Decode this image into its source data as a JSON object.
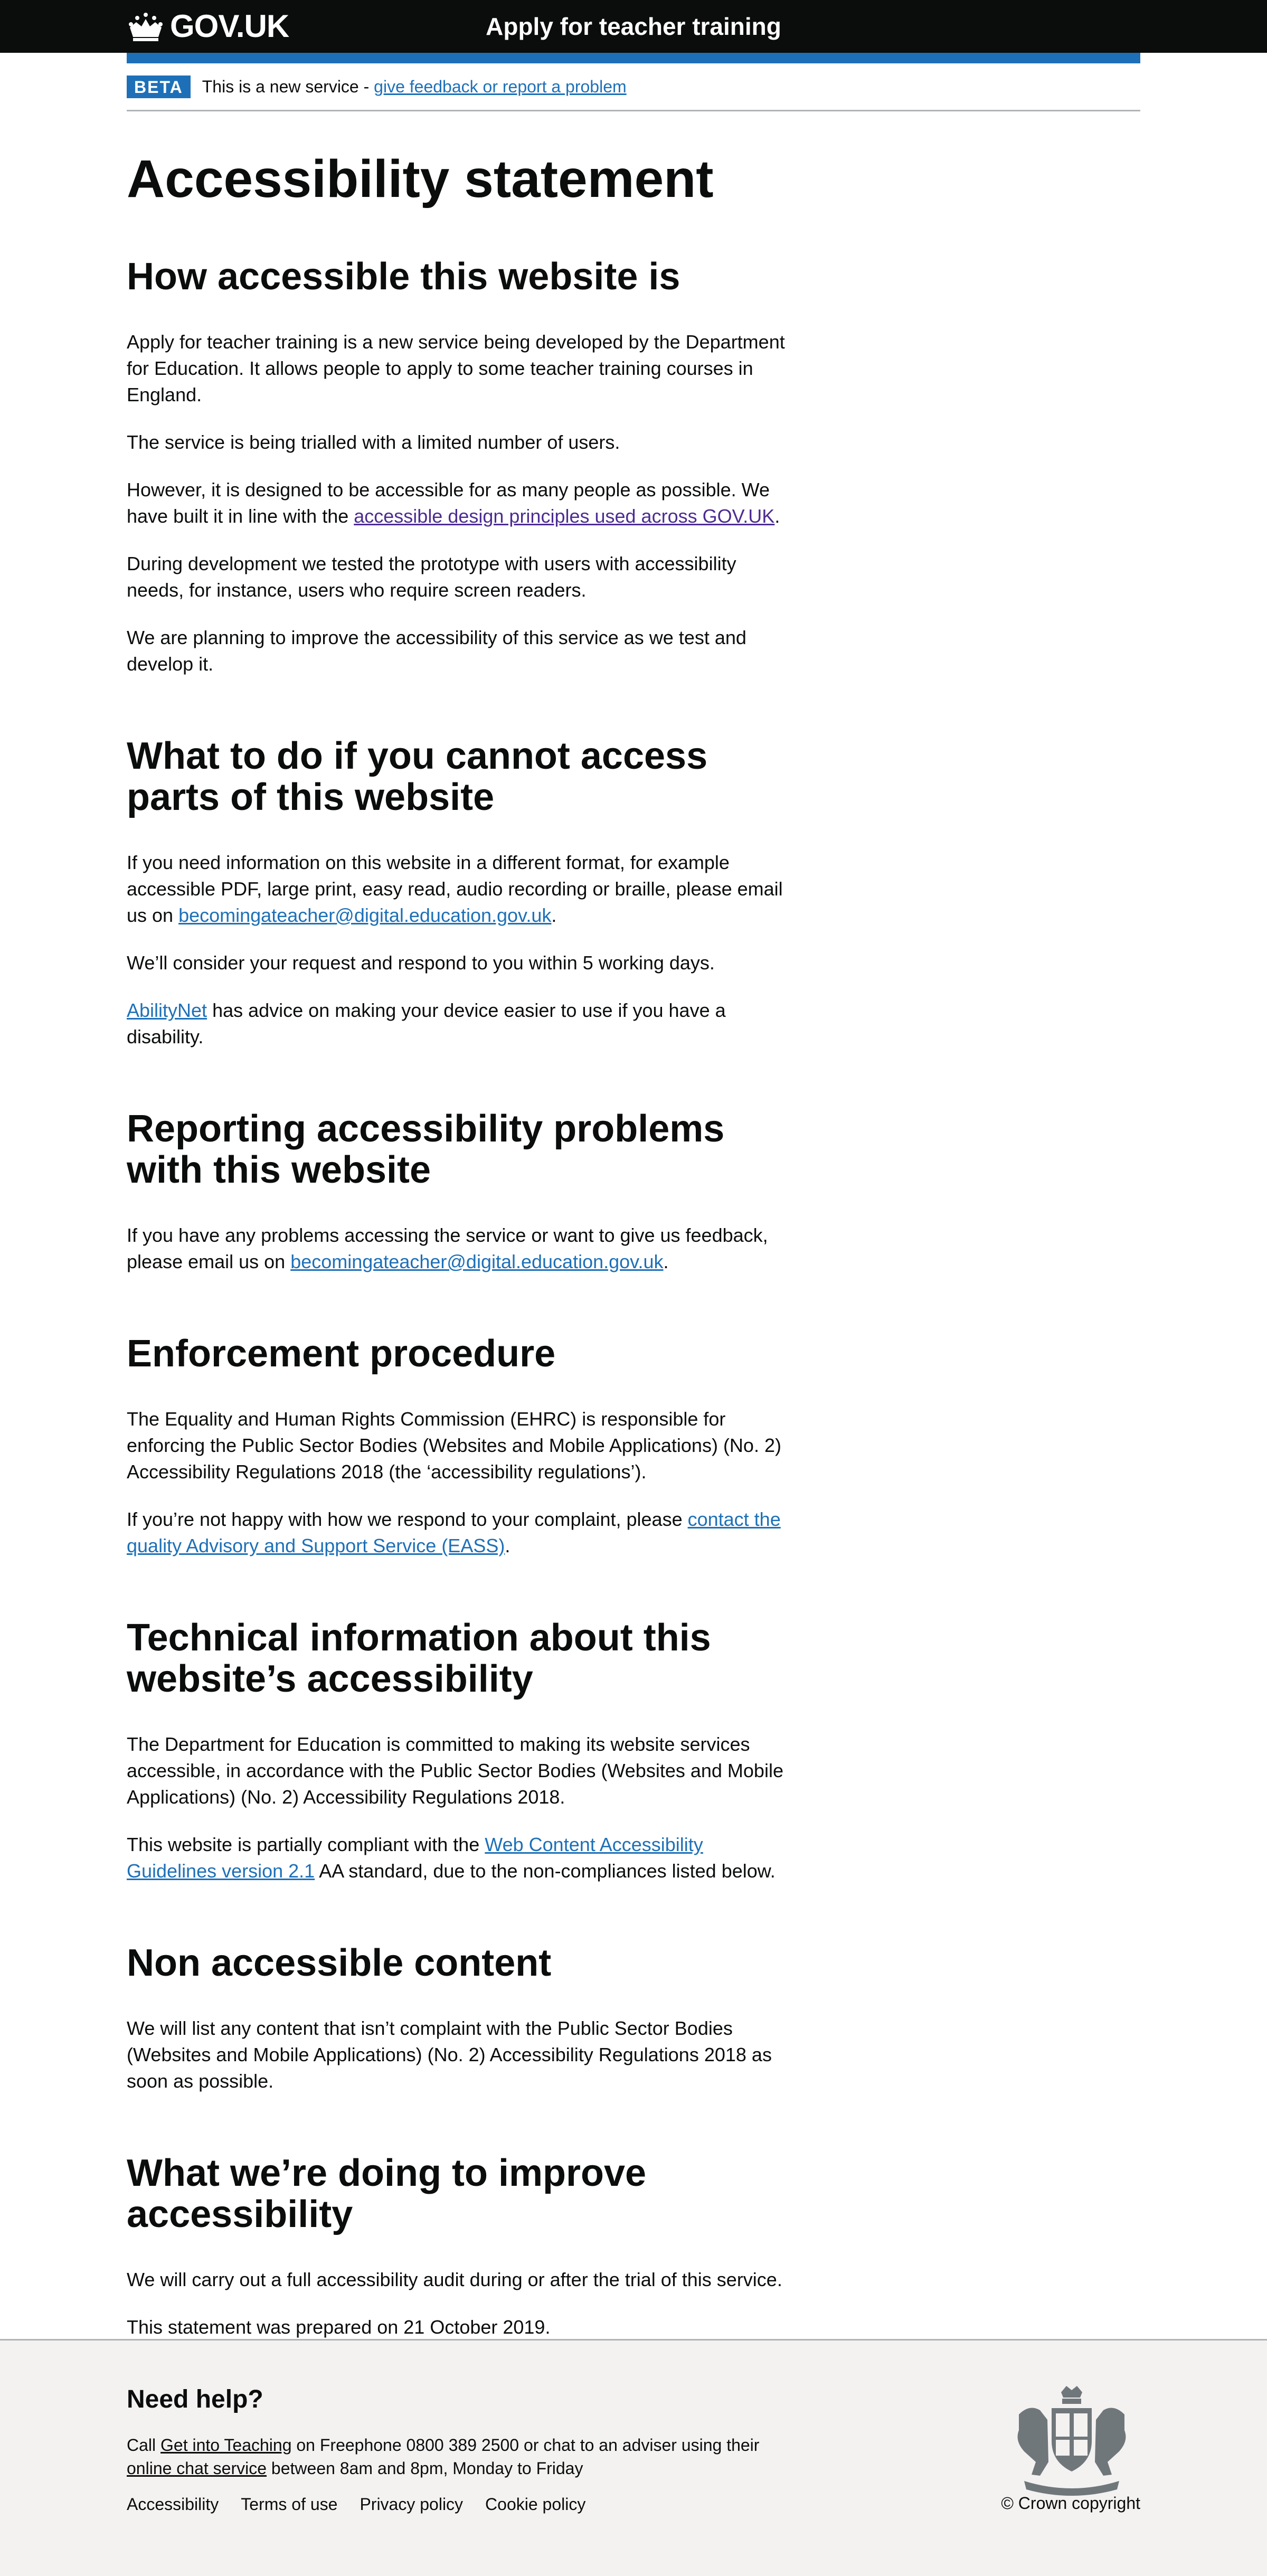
{
  "header": {
    "logo_text": "GOV.UK",
    "service_name": "Apply for teacher training"
  },
  "phase_banner": {
    "tag": "BETA",
    "text": "This is a new service - ",
    "link": "give feedback or report a problem"
  },
  "page": {
    "title": "Accessibility statement"
  },
  "sections": {
    "s1": {
      "heading": "How accessible this website is",
      "p1": "Apply for teacher training is a new service being developed by the Department for Education. It allows people to apply to some teacher training courses in England.",
      "p2": "The service is being trialled with a limited number of users.",
      "p3_a": "However, it is designed to be accessible for as many people as possible. We have built it in line with the ",
      "p3_link": "accessible design principles used across GOV.UK",
      "p3_b": ".",
      "p4": "During development we tested the prototype with users with accessibility needs, for instance, users who require screen readers.",
      "p5": "We are planning to improve the accessibility of this service as we test and develop it."
    },
    "s2": {
      "heading": "What to do if you cannot access parts of this website",
      "p1_a": "If you need information on this website in a different format, for example accessible PDF, large print, easy read, audio recording or braille, please email us on ",
      "p1_link": "becomingateacher@digital.education.gov.uk",
      "p1_b": ".",
      "p2": "We’ll consider your request and respond to you within 5 working days.",
      "p3_link": "AbilityNet",
      "p3_b": " has advice on making your device easier to use if you have a disability."
    },
    "s3": {
      "heading": "Reporting accessibility problems with this website",
      "p1_a": "If you have any problems accessing the service or want to give us feedback, please email us on ",
      "p1_link": "becomingateacher@digital.education.gov.uk",
      "p1_b": "."
    },
    "s4": {
      "heading": "Enforcement procedure",
      "p1": "The Equality and Human Rights Commission (EHRC) is responsible for enforcing the Public Sector Bodies (Websites and Mobile Applications) (No. 2) Accessibility Regulations 2018 (the ‘accessibility regulations’).",
      "p2_a": "If you’re not happy with how we respond to your complaint, please ",
      "p2_link": "contact the quality Advisory and Support Service (EASS)",
      "p2_b": "."
    },
    "s5": {
      "heading": "Technical information about this website’s accessibility",
      "p1": "The Department for Education is committed to making its website services accessible, in accordance with the Public Sector Bodies (Websites and Mobile Applications) (No. 2) Accessibility Regulations 2018.",
      "p2_a": "This website is partially compliant with the ",
      "p2_link": "Web Content Accessibility Guidelines version 2.1",
      "p2_b": " AA standard, due to the non-compliances listed below."
    },
    "s6": {
      "heading": "Non accessible content",
      "p1": "We will list any content that isn’t complaint with the Public Sector Bodies (Websites and Mobile Applications) (No. 2) Accessibility Regulations 2018 as soon as possible."
    },
    "s7": {
      "heading": "What we’re doing to improve accessibility",
      "p1": "We will carry out a full accessibility audit during or after the trial of this service.",
      "p2": "This statement was prepared on 21 October 2019."
    }
  },
  "footer": {
    "heading": "Need help?",
    "help_a": "Call ",
    "help_link1": "Get into Teaching",
    "help_b": " on Freephone 0800 389 2500 or chat to an adviser using their ",
    "help_link2": "online chat service",
    "help_c": " between 8am and 8pm, Monday to Friday",
    "links": [
      "Accessibility",
      "Terms of use",
      "Privacy policy",
      "Cookie policy"
    ],
    "copyright": "© Crown copyright"
  },
  "colors": {
    "header_bg": "#0b0c0c",
    "brand_blue": "#1d70b8",
    "visited_link": "#4c2c92",
    "footer_bg": "#f3f2f1"
  }
}
